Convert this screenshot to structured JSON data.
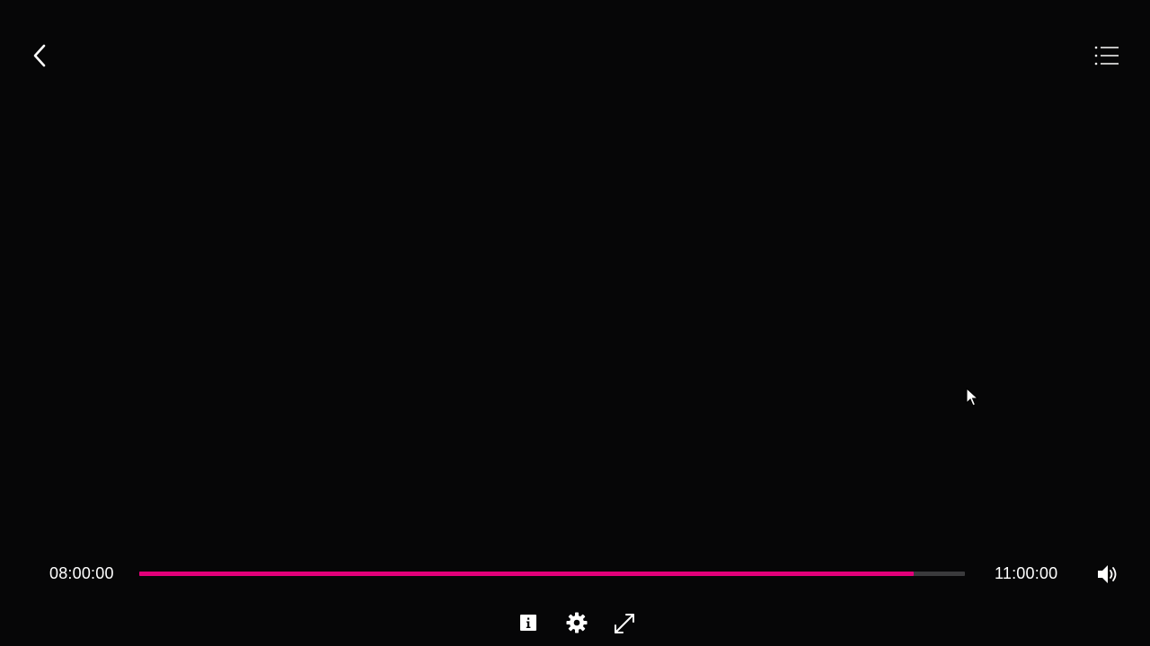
{
  "player": {
    "accent_color": "#e2007a",
    "background_color": "#060607",
    "track_color": "#3a3a3c"
  },
  "top_bar": {
    "back_icon": "chevron-left-icon",
    "playlist_icon": "list-icon"
  },
  "timeline": {
    "start_time": "08:00:00",
    "end_time": "11:00:00",
    "progress_fraction": 0.938
  },
  "controls": {
    "volume_icon": "speaker-icon",
    "info_icon": "info-icon",
    "settings_icon": "gear-icon",
    "fullscreen_icon": "expand-icon"
  }
}
